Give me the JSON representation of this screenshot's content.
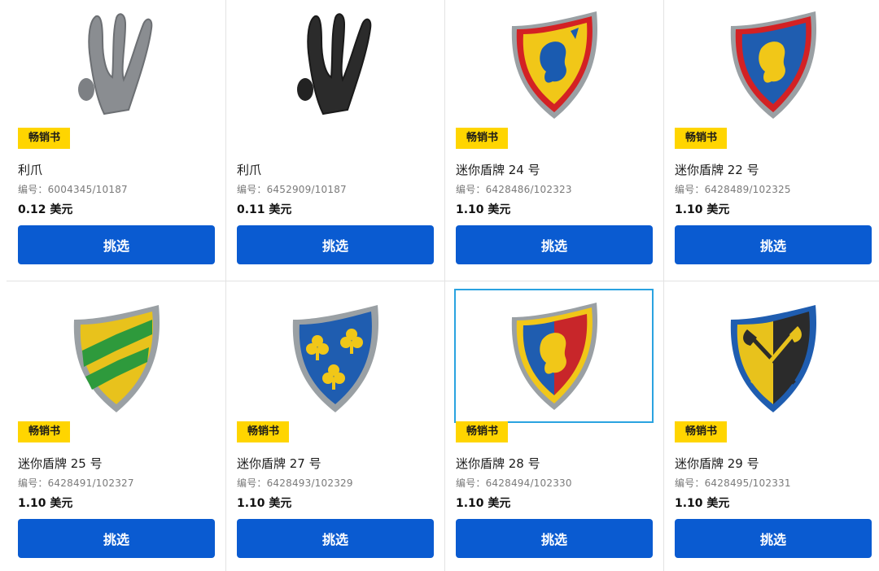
{
  "products": [
    {
      "badge": "畅销书",
      "name": "利爪",
      "code": "编号：6004345/10187",
      "price": "0.12 美元",
      "button": "挑选",
      "image": "claw-gray-icon",
      "color": "#8a8d91"
    },
    {
      "badge": "",
      "name": "利爪",
      "code": "编号：6452909/10187",
      "price": "0.11 美元",
      "button": "挑选",
      "image": "claw-black-icon",
      "color": "#2b2b2b"
    },
    {
      "badge": "畅销书",
      "name": "迷你盾牌 24 号",
      "code": "编号：6428486/102323",
      "price": "1.10 美元",
      "button": "挑选",
      "image": "shield-lion-yellow-icon",
      "color": "#e8c21c"
    },
    {
      "badge": "畅销书",
      "name": "迷你盾牌 22 号",
      "code": "编号：6428489/102325",
      "price": "1.10 美元",
      "button": "挑选",
      "image": "shield-lion-blue-icon",
      "color": "#1f5db0"
    },
    {
      "badge": "畅销书",
      "name": "迷你盾牌 25 号",
      "code": "编号：6428491/102327",
      "price": "1.10 美元",
      "button": "挑选",
      "image": "shield-chevron-icon",
      "color": "#2e9a3c"
    },
    {
      "badge": "畅销书",
      "name": "迷你盾牌 27 号",
      "code": "编号：6428493/102329",
      "price": "1.10 美元",
      "button": "挑选",
      "image": "shield-clubs-icon",
      "color": "#1f5db0"
    },
    {
      "badge": "畅销书",
      "name": "迷你盾牌 28 号",
      "code": "编号：6428494/102330",
      "price": "1.10 美元",
      "button": "挑选",
      "image": "shield-lion-split-icon",
      "color": "#c8262a"
    },
    {
      "badge": "畅销书",
      "name": "迷你盾牌 29 号",
      "code": "编号：6428495/102331",
      "price": "1.10 美元",
      "button": "挑选",
      "image": "shield-axes-icon",
      "color": "#e8c21c"
    }
  ]
}
